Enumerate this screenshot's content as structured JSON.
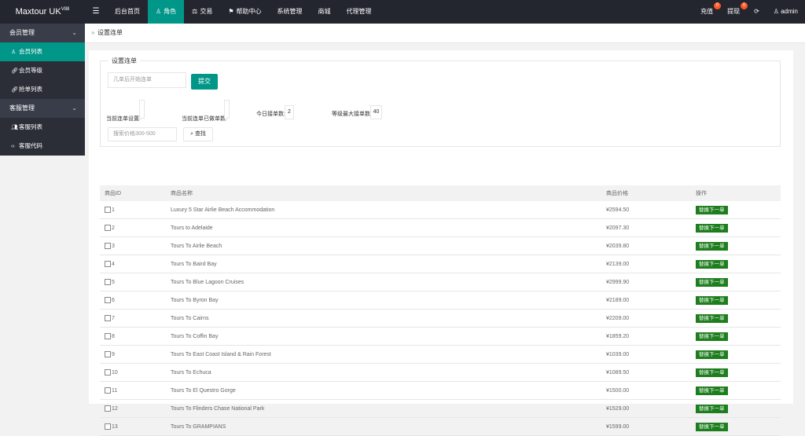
{
  "header": {
    "brand": "Maxtour UK",
    "brand_version": "V88",
    "menu_toggle_icon": "hamburger-icon",
    "nav": [
      {
        "label": "后台首页",
        "icon": "",
        "active": false
      },
      {
        "label": "角色",
        "icon": "user-icon",
        "active": true
      },
      {
        "label": "交易",
        "icon": "scale-icon",
        "active": false
      },
      {
        "label": "帮助中心",
        "icon": "flag-icon",
        "active": false
      },
      {
        "label": "系统管理",
        "icon": "",
        "active": false
      },
      {
        "label": "商城",
        "icon": "",
        "active": false
      },
      {
        "label": "代理管理",
        "icon": "",
        "active": false
      }
    ],
    "recharge_label": "充值",
    "recharge_badge": "0",
    "withdraw_label": "提现",
    "withdraw_badge": "0",
    "refresh_icon": "refresh-icon",
    "user_label": "admin"
  },
  "sidebar": {
    "groups": [
      {
        "label": "会员管理",
        "items": [
          {
            "label": "会员列表",
            "icon": "user-icon",
            "active": true
          },
          {
            "label": "会员等级",
            "icon": "link-icon",
            "active": false
          },
          {
            "label": "抢单列表",
            "icon": "link-icon",
            "active": false
          }
        ]
      },
      {
        "label": "客服管理",
        "items": [
          {
            "label": "客服列表",
            "icon": "users-icon",
            "active": false
          },
          {
            "label": "客服代码",
            "icon": "code-icon",
            "active": false
          }
        ]
      }
    ]
  },
  "breadcrumb": {
    "label": "设置连单"
  },
  "settings": {
    "legend": "设置连单",
    "after_orders_placeholder": "几单后开始连单",
    "submit_label": "提交",
    "current_combo_label": "当前连单设置:",
    "current_done_label": "当前连单已做单数:",
    "today_orders_label": "今日接单数:",
    "today_orders_value": "2",
    "level_max_label": "等级最大接单数:",
    "level_max_value": "40",
    "price_placeholder": "搜索价格300-500",
    "search_label": "查找"
  },
  "table": {
    "headers": [
      "商品ID",
      "商品名称",
      "商品价格",
      "操作"
    ],
    "action_label": "替换下一单",
    "rows": [
      {
        "id": "1",
        "name": "Luxury 5 Star Airlie Beach Accommodation",
        "price": "¥2594.50"
      },
      {
        "id": "2",
        "name": "Tours to Adelaide",
        "price": "¥2097.30"
      },
      {
        "id": "3",
        "name": "Tours To Airlie Beach",
        "price": "¥2039.80"
      },
      {
        "id": "4",
        "name": "Tours To Baird Bay",
        "price": "¥2139.00"
      },
      {
        "id": "5",
        "name": "Tours To Blue Lagoon Cruises",
        "price": "¥2999.90"
      },
      {
        "id": "6",
        "name": "Tours To Byron Bay",
        "price": "¥2189.00"
      },
      {
        "id": "7",
        "name": "Tours To Cairns",
        "price": "¥2209.00"
      },
      {
        "id": "8",
        "name": "Tours To Coffin Bay",
        "price": "¥1859.20"
      },
      {
        "id": "9",
        "name": "Tours To East Coast Island & Rain Forest",
        "price": "¥1039.00"
      },
      {
        "id": "10",
        "name": "Tours To Echuca",
        "price": "¥1089.50"
      },
      {
        "id": "11",
        "name": "Tours To El Questro Gorge",
        "price": "¥1500.00"
      },
      {
        "id": "12",
        "name": "Tours To Flinders Chase National Park",
        "price": "¥1529.00"
      },
      {
        "id": "13",
        "name": "Tours To GRAMPIANS",
        "price": "¥1599.00"
      }
    ]
  },
  "colors": {
    "topbar": "#23262e",
    "sidebar": "#393d49",
    "accent": "#009688",
    "action_button": "#1e7e1e",
    "badge": "#ff5722"
  }
}
